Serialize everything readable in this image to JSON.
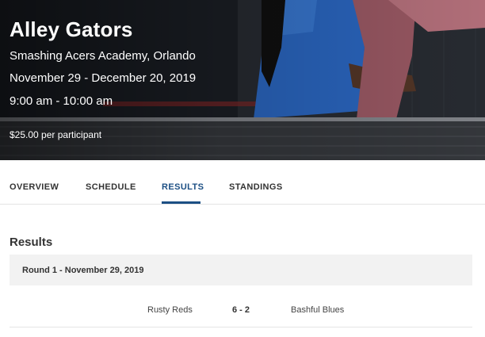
{
  "hero": {
    "title": "Alley Gators",
    "location": "Smashing Acers Academy, Orlando",
    "dates": "November 29 - December 20, 2019",
    "time": "9:00 am - 10:00 am",
    "price": "$25.00 per participant"
  },
  "tabs": [
    {
      "label": "OVERVIEW",
      "active": false
    },
    {
      "label": "SCHEDULE",
      "active": false
    },
    {
      "label": "RESULTS",
      "active": true
    },
    {
      "label": "STANDINGS",
      "active": false
    }
  ],
  "results": {
    "heading": "Results",
    "rounds": [
      {
        "label": "Round 1 - November 29, 2019",
        "matches": [
          {
            "home": "Rusty Reds",
            "score": "6 - 2",
            "away": "Bashful Blues"
          }
        ]
      }
    ]
  },
  "colors": {
    "accent": "#1c4f84",
    "round_bar_bg": "#f2f2f2",
    "divider": "#e4e4e4"
  }
}
